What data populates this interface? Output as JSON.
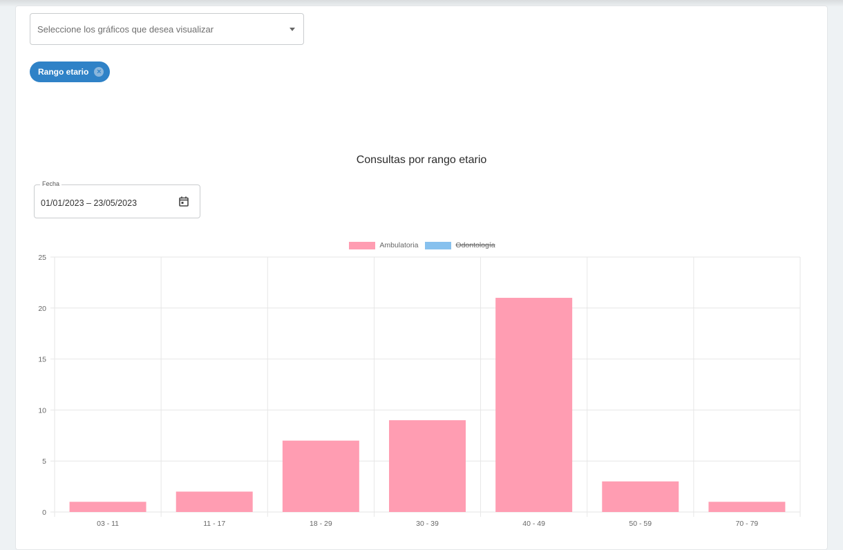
{
  "select": {
    "placeholder": "Seleccione los gráficos que desea visualizar"
  },
  "chip": {
    "label": "Rango etario",
    "close_icon": "×"
  },
  "chart": {
    "title": "Consultas por rango etario",
    "date_field": {
      "label": "Fecha",
      "value": "01/01/2023 – 23/05/2023"
    },
    "legend": [
      {
        "label": "Ambulatoria",
        "color": "#ff9db2",
        "hidden": false
      },
      {
        "label": "Odontología",
        "color": "#87c1ee",
        "hidden": true
      }
    ]
  },
  "chart_data": {
    "type": "bar",
    "categories": [
      "03 - 11",
      "11 - 17",
      "18 - 29",
      "30 - 39",
      "40 - 49",
      "50 - 59",
      "70 - 79"
    ],
    "series": [
      {
        "name": "Ambulatoria",
        "values": [
          1,
          2,
          7,
          9,
          21,
          3,
          1
        ],
        "color": "#ff9db2"
      },
      {
        "name": "Odontología",
        "hidden": true,
        "color": "#87c1ee"
      }
    ],
    "ylim": [
      0,
      25
    ],
    "yticks": [
      0,
      5,
      10,
      15,
      20,
      25
    ],
    "grid": true,
    "legend_position": "top"
  }
}
